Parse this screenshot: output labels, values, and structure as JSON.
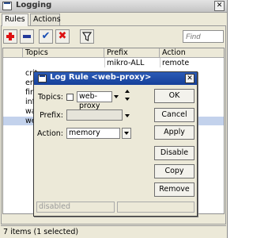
{
  "window": {
    "title": "Logging",
    "close_icon": "close-icon"
  },
  "tabs": [
    {
      "label": "Rules"
    },
    {
      "label": "Actions"
    }
  ],
  "toolbar": {
    "find_placeholder": "Find",
    "icons": [
      "add-icon",
      "remove-icon",
      "enable-icon",
      "disable-icon",
      "filter-icon"
    ],
    "colors": {
      "add": "#dd1111",
      "remove": "#223a9a",
      "enable": "#1a4fb5",
      "disable": "#dd1111"
    }
  },
  "table": {
    "columns": [
      "Topics",
      "Prefix",
      "Action"
    ],
    "rows": [
      {
        "topics": "",
        "prefix": "mikro-ALL",
        "action": "remote"
      },
      {
        "topics": "crit",
        "prefix": "",
        "action": ""
      },
      {
        "topics": "erro",
        "prefix": "",
        "action": ""
      },
      {
        "topics": "fire",
        "prefix": "",
        "action": ""
      },
      {
        "topics": "info",
        "prefix": "",
        "action": ""
      },
      {
        "topics": "wa",
        "prefix": "",
        "action": ""
      },
      {
        "topics": "we",
        "prefix": "",
        "action": ""
      }
    ],
    "selected_index": 6
  },
  "status": {
    "text": "7 items (1 selected)"
  },
  "dialog": {
    "title": "Log Rule <web-proxy>",
    "topics_label": "Topics:",
    "topics_value": "web-proxy",
    "prefix_label": "Prefix:",
    "prefix_value": "",
    "action_label": "Action:",
    "action_value": "memory",
    "buttons": {
      "ok": "OK",
      "cancel": "Cancel",
      "apply": "Apply",
      "disable": "Disable",
      "copy": "Copy",
      "remove": "Remove"
    },
    "status": "disabled",
    "title_bar_color": "#16409a"
  }
}
